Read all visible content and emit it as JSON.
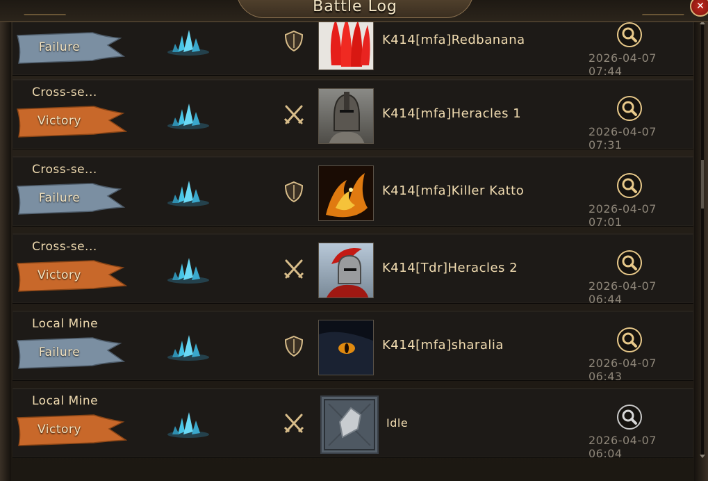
{
  "window": {
    "title": "Battle Log",
    "close_icon": "close-icon"
  },
  "colors": {
    "victory_banner": "#c8682a",
    "failure_banner": "#7b8fa2",
    "text_gold": "#f1dcb1",
    "timestamp_gray": "#8e8679"
  },
  "entries": [
    {
      "mode": "",
      "result": "Failure",
      "type_icon": "shield-icon",
      "player": "K414[mfa]Redbanana",
      "time": "2026-04-07 07:44",
      "avatar": "red-bananas"
    },
    {
      "mode": "Cross-se...",
      "result": "Victory",
      "type_icon": "crossed-swords-icon",
      "player": "K414[mfa]Heracles 1",
      "time": "2026-04-07 07:31",
      "avatar": "spartan-helmet"
    },
    {
      "mode": "Cross-se...",
      "result": "Failure",
      "type_icon": "shield-icon",
      "player": "K414[mfa]Killer Katto",
      "time": "2026-04-07 07:01",
      "avatar": "fire-creature"
    },
    {
      "mode": "Cross-se...",
      "result": "Victory",
      "type_icon": "crossed-swords-icon",
      "player": "K414[Tdr]Heracles 2",
      "time": "2026-04-07 06:44",
      "avatar": "red-crest-helmet"
    },
    {
      "mode": "Local Mine",
      "result": "Failure",
      "type_icon": "shield-icon",
      "player": "K414[mfa]sharalia",
      "time": "2026-04-07 06:43",
      "avatar": "wolf-eye"
    },
    {
      "mode": "Local Mine",
      "result": "Victory",
      "type_icon": "crossed-swords-icon",
      "player": "Idle",
      "time": "2026-04-07 06:04",
      "avatar": "crystal-tile"
    }
  ]
}
